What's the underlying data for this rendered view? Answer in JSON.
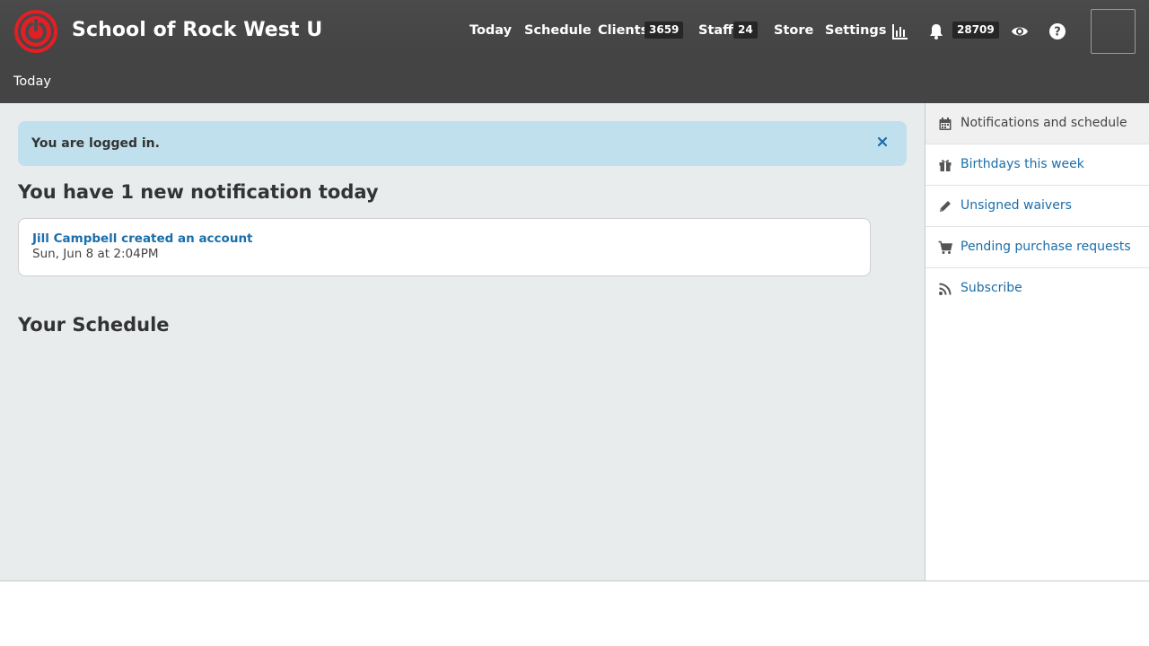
{
  "header": {
    "school_name": "School of Rock West U",
    "nav": {
      "today": "Today",
      "schedule": "Schedule",
      "clients": "Clients",
      "clients_count": "3659",
      "staff": "Staff",
      "staff_count": "24",
      "store": "Store",
      "settings": "Settings",
      "notifications_count": "28709"
    },
    "icons": [
      "logo-icon",
      "chart-icon",
      "bell-icon",
      "eye-icon",
      "help-icon"
    ],
    "accent_color": "#e01f26"
  },
  "subbar": {
    "title": "Today"
  },
  "main": {
    "alert": {
      "text": "You are logged in.",
      "close_icon": "close-icon"
    },
    "notifications_heading": "You have 1 new notification today",
    "notifications": [
      {
        "title": "Jill Campbell created an account",
        "time": "Sun, Jun 8 at 2:04PM"
      }
    ],
    "schedule_heading": "Your Schedule"
  },
  "sidebar": {
    "items": [
      {
        "label": "Notifications and schedule",
        "icon": "calendar-icon",
        "active": true
      },
      {
        "label": "Birthdays this week",
        "icon": "gift-icon",
        "active": false
      },
      {
        "label": "Unsigned waivers",
        "icon": "pencil-icon",
        "active": false
      },
      {
        "label": "Pending purchase requests",
        "icon": "cart-icon",
        "active": false
      },
      {
        "label": "Subscribe",
        "icon": "rss-icon",
        "active": false
      }
    ]
  },
  "colors": {
    "link": "#1a6eaa",
    "alert_bg": "#bfe0ec",
    "header_bg": "#4a4a4a",
    "main_bg": "#e8ecec"
  }
}
